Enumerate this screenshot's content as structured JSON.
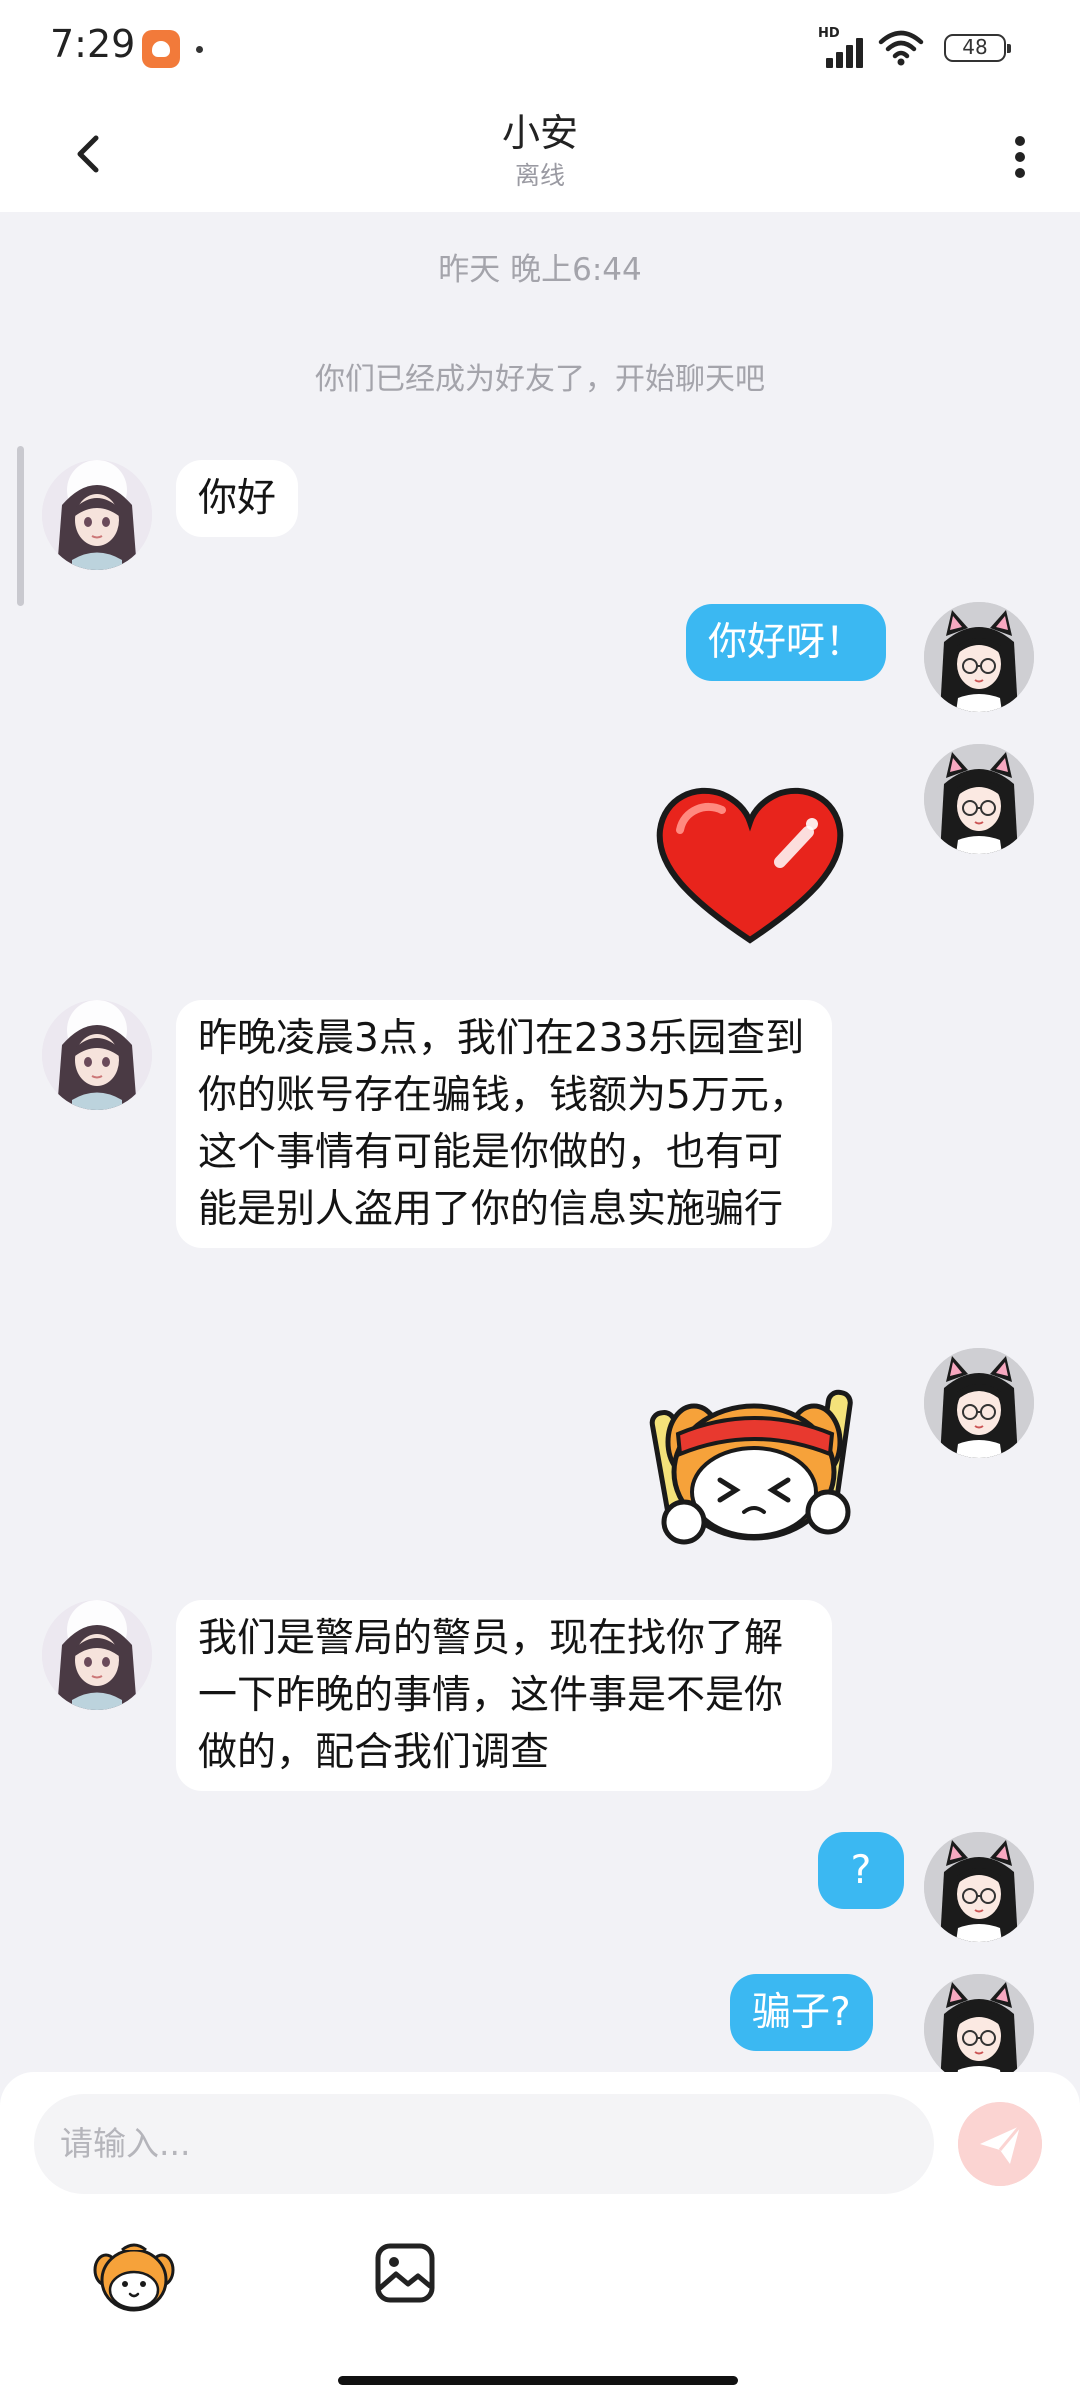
{
  "status_bar": {
    "time": "7:29",
    "network_label": "HD",
    "battery": "48"
  },
  "header": {
    "title": "小安",
    "subtitle": "离线"
  },
  "chat": {
    "timestamp": "昨天 晚上6:44",
    "system_message": "你们已经成为好友了，开始聊天吧",
    "messages": [
      {
        "side": "left",
        "type": "text",
        "text": "你好"
      },
      {
        "side": "right",
        "type": "text",
        "text": "你好呀！"
      },
      {
        "side": "right",
        "type": "sticker",
        "sticker": "red-heart"
      },
      {
        "side": "left",
        "type": "text",
        "text": "昨晚凌晨3点，我们在233乐园查到你的账号存在骗钱，钱额为5万元，这个事情有可能是你做的，也有可能是别人盗用了你的信息实施骗行"
      },
      {
        "side": "right",
        "type": "sticker",
        "sticker": "cheering-mascot"
      },
      {
        "side": "left",
        "type": "text",
        "text": "我们是警局的警员，现在找你了解一下昨晚的事情，这件事是不是你做的，配合我们调查"
      },
      {
        "side": "right",
        "type": "text",
        "text": "?"
      },
      {
        "side": "right",
        "type": "text",
        "text": "骗子?"
      }
    ]
  },
  "input": {
    "placeholder": "请输入..."
  },
  "colors": {
    "outgoing_bubble": "#3bb8f2",
    "incoming_bubble": "#ffffff",
    "background": "#f2f2f6",
    "send_button": "#fbd4d2"
  },
  "icons": [
    "back-arrow-icon",
    "more-vertical-icon",
    "send-icon",
    "emoji-mascot-icon",
    "image-icon",
    "signal-icon",
    "wifi-icon",
    "battery-icon"
  ]
}
